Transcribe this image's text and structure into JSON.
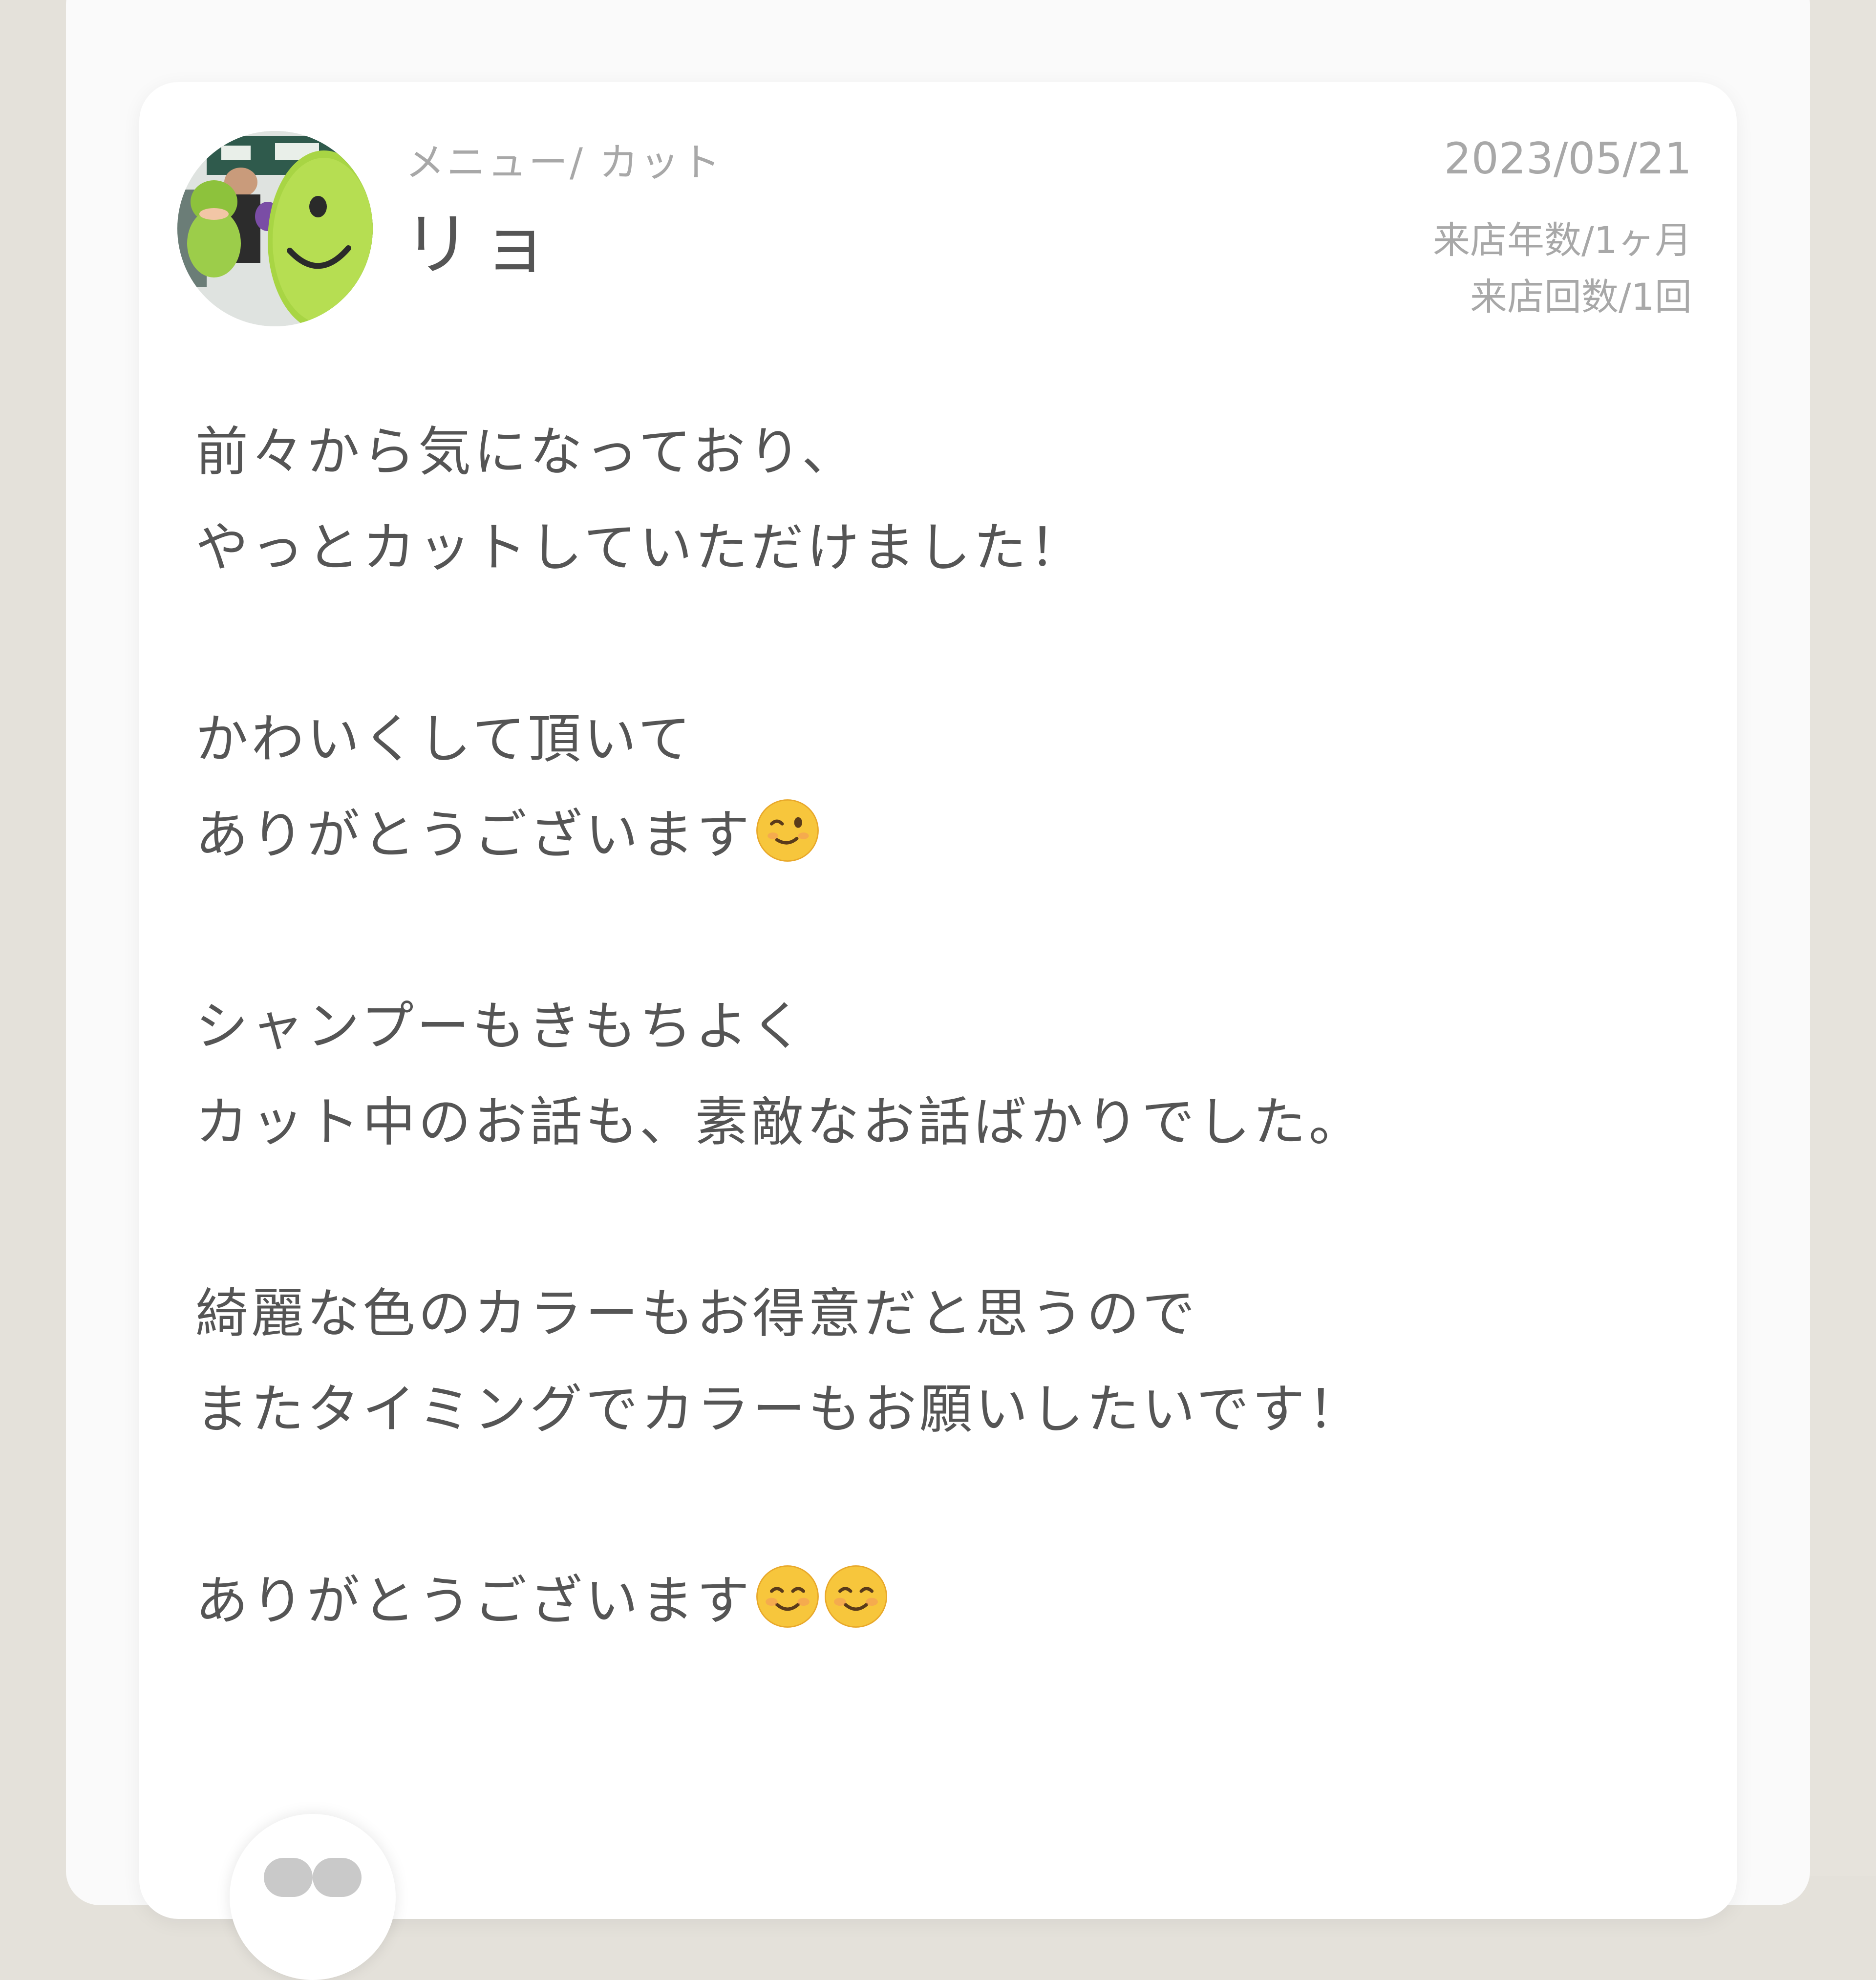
{
  "review": {
    "menu": "メニュー/ カット",
    "name": "リョ",
    "date": "2023/05/21",
    "visit_years": "来店年数/1ヶ月",
    "visit_count": "来店回数/1回",
    "lines": [
      "前々から気になっており、",
      "やっとカットしていただけました！",
      "かわいくして頂いて",
      "ありがとうございます",
      "シャンプーもきもちよく",
      "カット中のお話も、素敵なお話ばかりでした。",
      "綺麗な色のカラーもお得意だと思うので",
      "またタイミングでカラーもお願いしたいです！",
      "ありがとうございます"
    ],
    "emojis": [
      "winking-face",
      "smiling-face",
      "smiling-face"
    ]
  },
  "colors": {
    "background": "#e4e1da",
    "card": "#ffffff",
    "text": "#555555",
    "muted_text": "#a8a8a8",
    "emoji_yellow": "#f7c63c"
  }
}
